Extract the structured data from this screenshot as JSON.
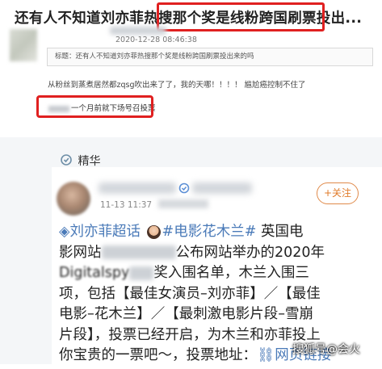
{
  "forum": {
    "headline": "还有人不知道刘亦菲热搜那个奖是线粉跨国刷票投出...",
    "timestamp": "2020-12-28 08:46:38",
    "quote": "标题：还有人不知道刘亦菲热搜那个奖是线粉跨国刷票投出来的吗",
    "body": "从粉丝到蒸煮居然都zqsg吹出来了了，我的天哪！！！！ 尴尬癌控制不住了",
    "call_text": "一个月前就下场号召投票"
  },
  "weibo": {
    "featured_label": "精华",
    "time": "11-13 11:37",
    "follow_label": "+关注",
    "line1_tag1": "刘亦菲超话",
    "line1_tag2": "#电影花木兰#",
    "line1_rest": "英国电",
    "line2_a": "影网站",
    "line2_b": "公布网站举办的2020年",
    "line3_a": "Digitalspy",
    "line3_b": "奖入围名单，木兰入围三",
    "line4": "项，包括【最佳女演员–刘亦菲】／【最佳",
    "line5": "电影–花木兰】／【最刺激电影片段–雪崩",
    "line6": "片段】，投票已经开启，为木兰和亦菲投上",
    "line7_a": "你宝贵的一票吧～，投票地址：",
    "line7_link": "网页链接"
  },
  "watermark": "搜狐号@会火",
  "icons": {
    "featured": "featured-icon",
    "verify": "verified-icon",
    "tag": "supertopic-icon",
    "emoji": "girl-emoji-icon",
    "link": "link-icon"
  },
  "colors": {
    "highlight_box": "#e02020",
    "tag": "#4a7ab8",
    "follow": "#e07b2a"
  }
}
